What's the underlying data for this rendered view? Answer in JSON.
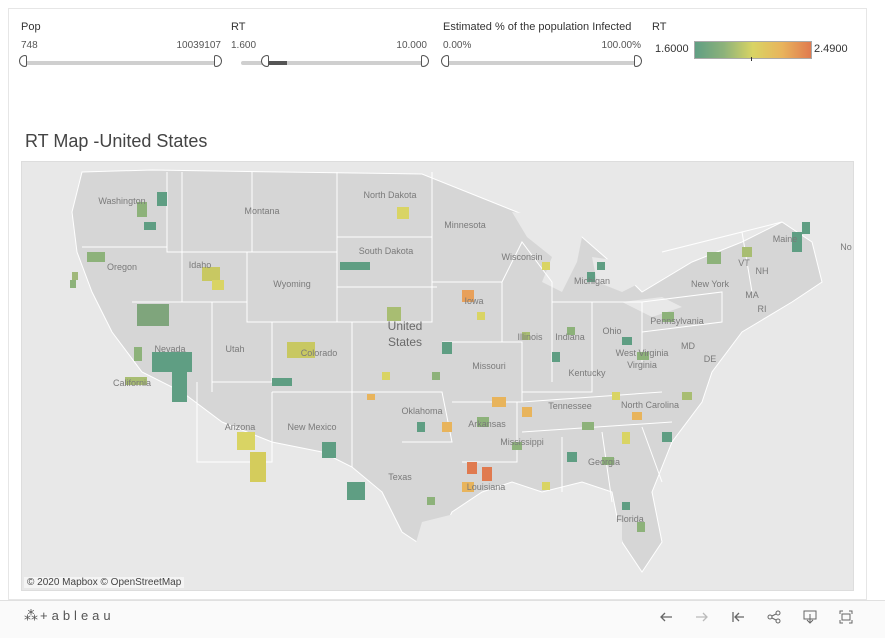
{
  "filters": {
    "pop": {
      "title": "Pop",
      "min_label": "748",
      "max_label": "10039107",
      "selected_low": 0.0,
      "selected_high": 1.0
    },
    "rt": {
      "title": "RT",
      "min_label": "1.600",
      "max_label": "10.000",
      "selected_low": 0.13,
      "selected_high": 1.0
    },
    "infected": {
      "title": "Estimated % of the population Infected",
      "min_label": "0.00%",
      "max_label": "100.00%",
      "selected_low": 0.0,
      "selected_high": 1.0
    }
  },
  "legend": {
    "title": "RT",
    "min_label": "1.6000",
    "max_label": "2.4900",
    "colors": [
      "#5f9e83",
      "#d9d464",
      "#e07a4f"
    ]
  },
  "map": {
    "title": "RT Map -United States",
    "attribution": "© 2020 Mapbox  © OpenStreetMap",
    "country_label": "United\nStates",
    "state_labels": [
      "Washington",
      "Montana",
      "North Dakota",
      "Minnesota",
      "Oregon",
      "Idaho",
      "South Dakota",
      "Wisconsin",
      "Michigan",
      "Wyoming",
      "Iowa",
      "Nevada",
      "Utah",
      "Colorado",
      "Illinois",
      "Indiana",
      "Ohio",
      "Pennsylvania",
      "New York",
      "California",
      "Missouri",
      "Kentucky",
      "West Virginia",
      "Virginia",
      "Arizona",
      "New Mexico",
      "Oklahoma",
      "Arkansas",
      "Tennessee",
      "North Carolina",
      "Mississippi",
      "Texas",
      "Louisiana",
      "Georgia",
      "Florida",
      "Maine",
      "VT",
      "NH",
      "MA",
      "RI",
      "MD",
      "DE",
      "No"
    ]
  },
  "toolbar": {
    "logo": "+ableau",
    "icons": [
      "undo-icon",
      "redo-icon",
      "revert-icon",
      "share-icon",
      "download-icon",
      "fullscreen-icon"
    ]
  }
}
